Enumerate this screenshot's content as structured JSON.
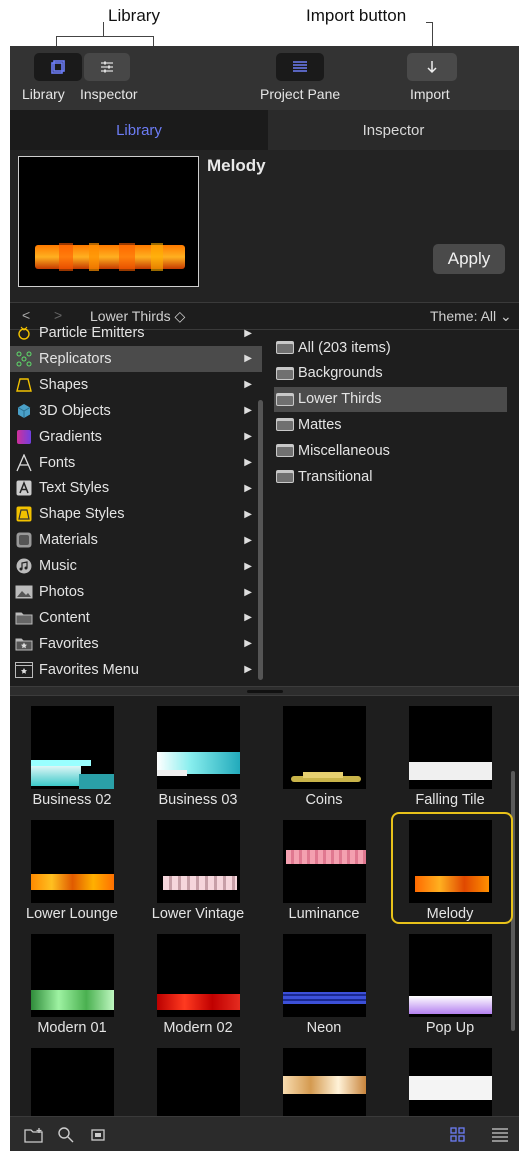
{
  "callouts": {
    "library": "Library",
    "import_button": "Import button"
  },
  "toolbar": {
    "library_label": "Library",
    "inspector_label": "Inspector",
    "project_pane_label": "Project Pane",
    "import_label": "Import"
  },
  "tabs": {
    "library": "Library",
    "inspector": "Inspector"
  },
  "preview": {
    "title": "Melody",
    "apply_label": "Apply"
  },
  "navbar": {
    "back": "<",
    "forward": ">",
    "path": "Lower Thirds ◇",
    "theme": "Theme: All ⌄"
  },
  "categories": [
    {
      "label": "Particle Emitters",
      "icon": "particle-emitters-icon"
    },
    {
      "label": "Replicators",
      "icon": "replicators-icon",
      "selected": true
    },
    {
      "label": "Shapes",
      "icon": "shapes-icon"
    },
    {
      "label": "3D Objects",
      "icon": "3d-objects-icon"
    },
    {
      "label": "Gradients",
      "icon": "gradients-icon"
    },
    {
      "label": "Fonts",
      "icon": "fonts-icon"
    },
    {
      "label": "Text Styles",
      "icon": "text-styles-icon"
    },
    {
      "label": "Shape Styles",
      "icon": "shape-styles-icon"
    },
    {
      "label": "Materials",
      "icon": "materials-icon"
    },
    {
      "label": "Music",
      "icon": "music-icon"
    },
    {
      "label": "Photos",
      "icon": "photos-icon"
    },
    {
      "label": "Content",
      "icon": "content-icon"
    },
    {
      "label": "Favorites",
      "icon": "favorites-icon"
    },
    {
      "label": "Favorites Menu",
      "icon": "favorites-menu-icon"
    }
  ],
  "subcategories": [
    {
      "label": "All (203 items)"
    },
    {
      "label": "Backgrounds"
    },
    {
      "label": "Lower Thirds",
      "selected": true
    },
    {
      "label": "Mattes"
    },
    {
      "label": "Miscellaneous"
    },
    {
      "label": "Transitional"
    }
  ],
  "tiles": [
    {
      "label": "Business 02"
    },
    {
      "label": "Business 03"
    },
    {
      "label": "Coins"
    },
    {
      "label": "Falling Tile"
    },
    {
      "label": "Lower Lounge"
    },
    {
      "label": "Lower Vintage"
    },
    {
      "label": "Luminance"
    },
    {
      "label": "Melody",
      "selected": true
    },
    {
      "label": "Modern 01"
    },
    {
      "label": "Modern 02"
    },
    {
      "label": "Neon"
    },
    {
      "label": "Pop Up"
    },
    {
      "label": ""
    },
    {
      "label": ""
    },
    {
      "label": ""
    },
    {
      "label": ""
    }
  ],
  "colors": {
    "accent_tab": "#6c7cf5",
    "selection_border": "#e8c21a",
    "toolbar_bg": "#333333",
    "panel_bg": "#1e1e1e"
  }
}
